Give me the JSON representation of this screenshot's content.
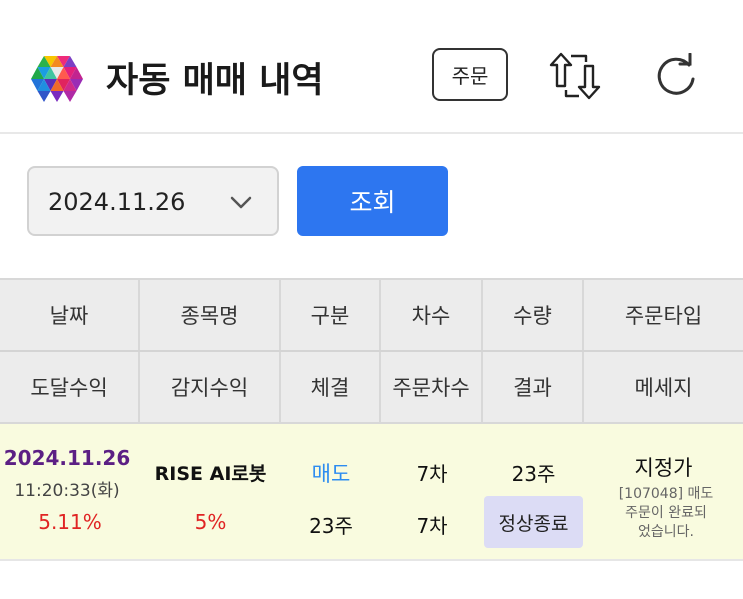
{
  "header": {
    "title": "자동 매매 내역",
    "order_label": "주문"
  },
  "filter": {
    "date_value": "2024.11.26",
    "search_label": "조회"
  },
  "table": {
    "header_row1": [
      "날짜",
      "종목명",
      "구분",
      "차수",
      "수량",
      "주문타입"
    ],
    "header_row2": [
      "도달수익",
      "감지수익",
      "체결",
      "주문차수",
      "결과",
      "메세지"
    ],
    "rows": [
      {
        "date": "2024.11.26",
        "time": "11:20:33(화)",
        "reach_profit": "5.11%",
        "stock_name": "RISE AI로봇",
        "detect_profit": "5%",
        "side": "매도",
        "filled_qty": "23주",
        "degree": "7차",
        "order_degree": "7차",
        "quantity": "23주",
        "result": "정상종료",
        "order_type": "지정가",
        "message_line1": "[107048] 매도",
        "message_line2": "주문이 완료되",
        "message_line3": "었습니다."
      }
    ]
  },
  "colors": {
    "accent_blue": "#2d76f0",
    "sell_blue": "#2d8cf0",
    "profit_red": "#e02424",
    "date_purple": "#5c1f84",
    "row_highlight": "#f9fbdf",
    "result_badge": "#dcdcf5"
  },
  "icons": {
    "logo": "colorful-hexagon-logo",
    "swap": "swap-arrows-icon",
    "refresh": "refresh-icon",
    "dropdown": "chevron-down-icon"
  }
}
